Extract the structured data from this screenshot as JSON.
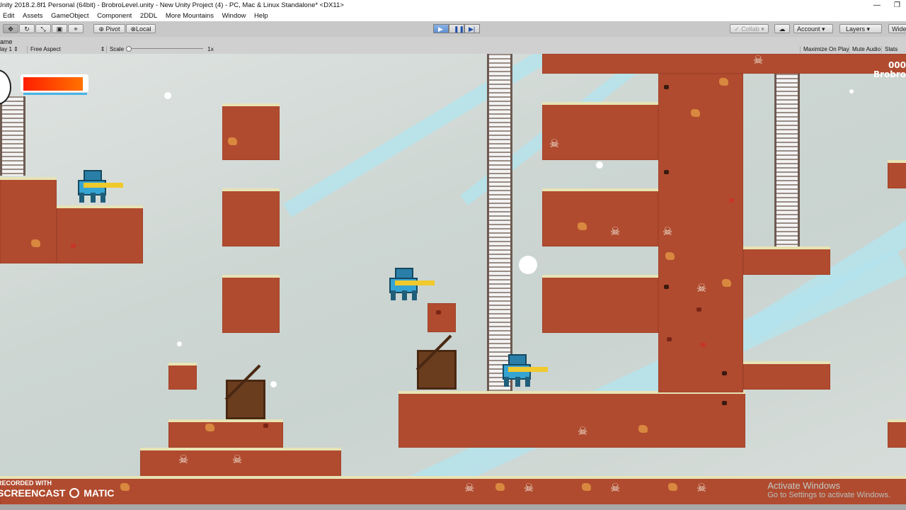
{
  "window": {
    "title": "Unity 2018.2.8f1 Personal (64bit) - BrobroLevel.unity - New Unity Project (4) - PC, Mac & Linux Standalone* <DX11>",
    "minimize_glyph": "—",
    "restore_glyph": "❐"
  },
  "menu": [
    "Edit",
    "Assets",
    "GameObject",
    "Component",
    "2DDL",
    "More Mountains",
    "Window",
    "Help"
  ],
  "toolbar": {
    "tools": [
      "hand-tool",
      "move-tool",
      "rotate-tool",
      "scale-tool",
      "rect-tool",
      "transform-tool"
    ],
    "pivot_label": "Pivot",
    "local_label": "Local",
    "play_state": "playing",
    "collab_label": "Collab",
    "account_label": "Account",
    "layers_label": "Layers",
    "layout_label": "Wide"
  },
  "game_view": {
    "tab_label": "ame",
    "display_label": "lay 1",
    "aspect_label": "Free Aspect",
    "scale_label": "Scale",
    "scale_value": "1x",
    "maximize_label": "Maximize On Play",
    "mute_label": "Mute Audio",
    "stats_label": "Stats"
  },
  "hud": {
    "health_fraction": 0.95,
    "score": "000",
    "player_name": "Brobro"
  },
  "overlays": {
    "recorder_line1": "RECORDED WITH",
    "recorder_line2": "SCREENCAST",
    "recorder_line3": "MATIC",
    "activate_line1": "Activate Windows",
    "activate_line2": "Go to Settings to activate Windows."
  },
  "colors": {
    "ground": "#b04b2f",
    "grass_top": "#e8e3b5",
    "robot": "#36a4d2",
    "gun": "#f0c92c",
    "health": "#ff3a00"
  }
}
